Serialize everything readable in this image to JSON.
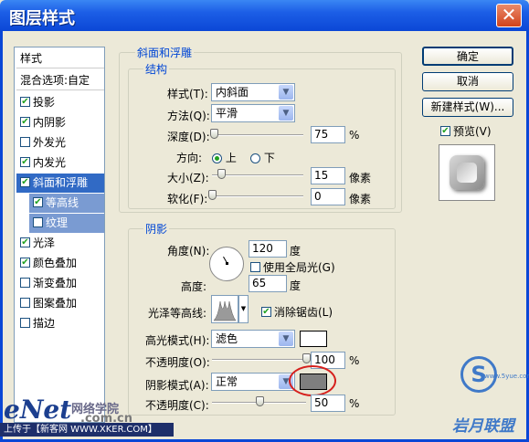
{
  "window": {
    "title": "图层样式",
    "close": "✕"
  },
  "left_list": {
    "header": "样式",
    "blend": "混合选项:自定",
    "items": [
      {
        "label": "投影",
        "checked": true
      },
      {
        "label": "内阴影",
        "checked": true
      },
      {
        "label": "外发光",
        "checked": false
      },
      {
        "label": "内发光",
        "checked": true
      },
      {
        "label": "斜面和浮雕",
        "checked": true
      },
      {
        "label": "等高线",
        "checked": true
      },
      {
        "label": "纹理",
        "checked": false
      },
      {
        "label": "光泽",
        "checked": true
      },
      {
        "label": "颜色叠加",
        "checked": true
      },
      {
        "label": "渐变叠加",
        "checked": false
      },
      {
        "label": "图案叠加",
        "checked": false
      },
      {
        "label": "描边",
        "checked": false
      }
    ]
  },
  "bevel": {
    "group_title": "斜面和浮雕",
    "structure_title": "结构",
    "style_label": "样式(T):",
    "style_value": "内斜面",
    "method_label": "方法(Q):",
    "method_value": "平滑",
    "depth_label": "深度(D):",
    "depth_value": "75",
    "depth_unit": "%",
    "depth_pos": 0.02,
    "direction_label": "方向:",
    "dir_up": "上",
    "dir_down": "下",
    "size_label": "大小(Z):",
    "size_value": "15",
    "size_unit": "像素",
    "size_pos": 0.1,
    "soften_label": "软化(F):",
    "soften_value": "0",
    "soften_unit": "像素",
    "soften_pos": 0.0
  },
  "shading": {
    "title": "阴影",
    "angle_label": "角度(N):",
    "angle_value": "120",
    "angle_unit": "度",
    "global_light": "使用全局光(G)",
    "altitude_label": "高度:",
    "altitude_value": "65",
    "altitude_unit": "度",
    "gloss_label": "光泽等高线:",
    "antialias": "消除锯齿(L)",
    "highlight_mode_label": "高光模式(H):",
    "highlight_mode_value": "滤色",
    "highlight_color": "#ffffff",
    "highlight_opacity_label": "不透明度(O):",
    "highlight_opacity": "100",
    "opacity_unit": "%",
    "highlight_pos": 1.0,
    "shadow_mode_label": "阴影模式(A):",
    "shadow_mode_value": "正常",
    "shadow_color": "#7f7f7f",
    "shadow_opacity_label": "不透明度(C):",
    "shadow_opacity": "50",
    "shadow_pos": 0.5
  },
  "buttons": {
    "ok": "确定",
    "cancel": "取消",
    "new_style": "新建样式(W)...",
    "preview": "预览(V)"
  },
  "watermark": {
    "left": "eNet",
    "left2": "网络学院",
    "left3": ".com.cn",
    "caption": "上传于【新客网 WWW.XKER.COM】",
    "right": "岩月联盟",
    "right_small": "www.5yue.com"
  }
}
